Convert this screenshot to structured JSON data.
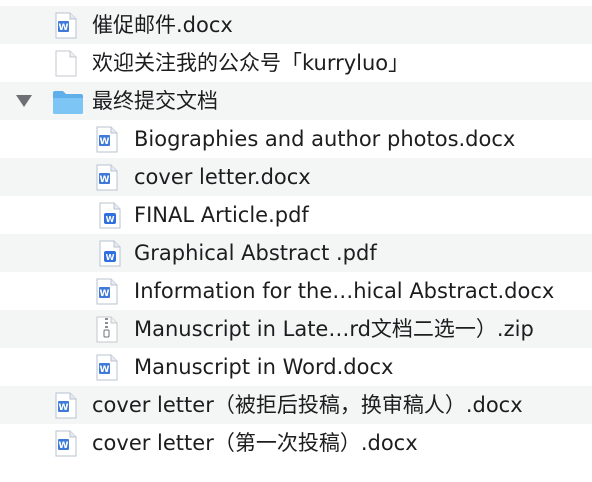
{
  "colors": {
    "alt_row": "#f4f5f5",
    "doc_blue": "#3f7ad9",
    "folder_blue": "#6cbcf0",
    "pdf_blue": "#2f6fe0"
  },
  "items": [
    {
      "name": "催促邮件.docx",
      "icon": "word-doc-icon"
    },
    {
      "name": "欢迎关注我的公众号「kurryluo」",
      "icon": "blank-file-icon"
    },
    {
      "name": "最终提交文档",
      "icon": "folder-icon",
      "expanded": true
    },
    {
      "name": "Biographies and author photos.docx",
      "icon": "word-doc-icon"
    },
    {
      "name": "cover letter.docx",
      "icon": "word-doc-icon"
    },
    {
      "name": "FINAL Article.pdf",
      "icon": "pdf-icon"
    },
    {
      "name": "Graphical Abstract .pdf",
      "icon": "pdf-icon"
    },
    {
      "name": "Information for the…hical Abstract.docx",
      "icon": "word-doc-icon"
    },
    {
      "name": "Manuscript in Late…rd文档二选一）.zip",
      "icon": "zip-icon"
    },
    {
      "name": "Manuscript in Word.docx",
      "icon": "word-doc-icon"
    },
    {
      "name": "cover letter（被拒后投稿，换审稿人）.docx",
      "icon": "word-doc-icon"
    },
    {
      "name": "cover letter（第一次投稿）.docx",
      "icon": "word-doc-icon"
    }
  ]
}
